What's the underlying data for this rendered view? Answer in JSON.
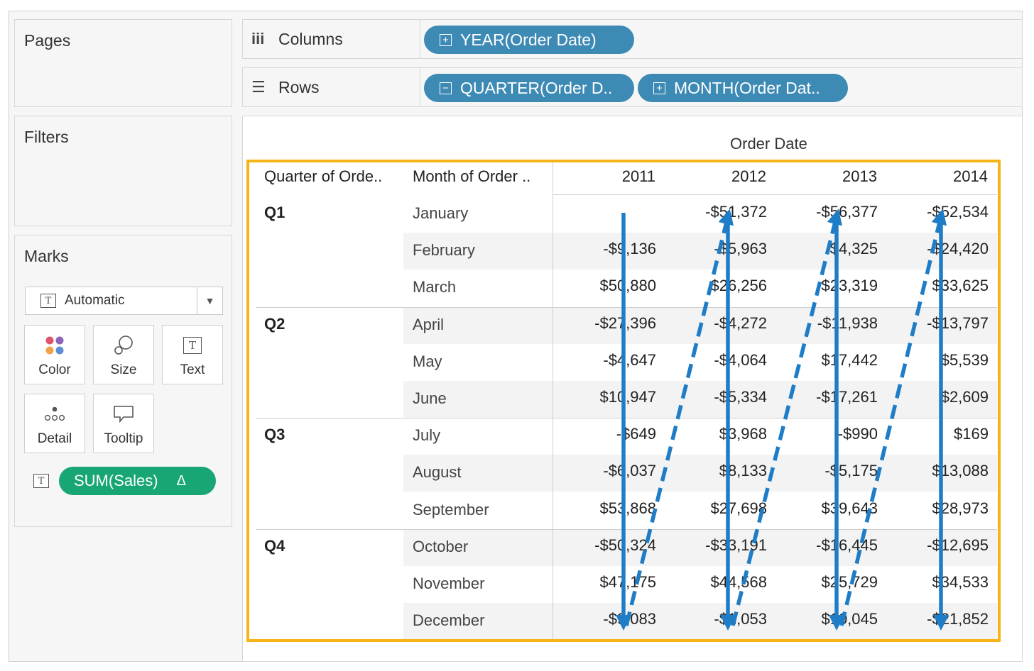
{
  "panels": {
    "pages": "Pages",
    "filters": "Filters",
    "marks": "Marks"
  },
  "marks": {
    "type_label": "Automatic",
    "buttons": [
      "Color",
      "Size",
      "Text",
      "Detail",
      "Tooltip"
    ],
    "pill_label": "SUM(Sales)",
    "pill_delta": "Δ"
  },
  "shelves": {
    "columns_label": "Columns",
    "rows_label": "Rows",
    "columns_pills": [
      "YEAR(Order Date)"
    ],
    "rows_pills": [
      "QUARTER(Order D..",
      "MONTH(Order Dat.."
    ]
  },
  "table": {
    "column_header": "Order Date",
    "row_headers": [
      "Quarter of Orde..",
      "Month of Order .."
    ],
    "years": [
      "2011",
      "2012",
      "2013",
      "2014"
    ],
    "quarters": [
      "Q1",
      "Q2",
      "Q3",
      "Q4"
    ],
    "rows": [
      {
        "month": "January",
        "values": [
          "",
          "-$51,372",
          "-$56,377",
          "-$52,534"
        ]
      },
      {
        "month": "February",
        "values": [
          "-$9,136",
          "-$5,963",
          "$4,325",
          "-$24,420"
        ]
      },
      {
        "month": "March",
        "values": [
          "$50,880",
          "$26,256",
          "$23,319",
          "$33,625"
        ]
      },
      {
        "month": "April",
        "values": [
          "-$27,396",
          "-$4,272",
          "-$11,938",
          "-$13,797"
        ]
      },
      {
        "month": "May",
        "values": [
          "-$4,647",
          "-$4,064",
          "$17,442",
          "$5,539"
        ]
      },
      {
        "month": "June",
        "values": [
          "$10,947",
          "-$5,334",
          "-$17,261",
          "$2,609"
        ]
      },
      {
        "month": "July",
        "values": [
          "-$649",
          "$3,968",
          "-$990",
          "$169"
        ]
      },
      {
        "month": "August",
        "values": [
          "-$6,037",
          "$8,133",
          "-$5,175",
          "$13,088"
        ]
      },
      {
        "month": "September",
        "values": [
          "$53,868",
          "$27,698",
          "$39,643",
          "$28,973"
        ]
      },
      {
        "month": "October",
        "values": [
          "-$50,324",
          "-$33,191",
          "-$16,445",
          "-$12,695"
        ]
      },
      {
        "month": "November",
        "values": [
          "$47,175",
          "$44,568",
          "$25,729",
          "$34,533"
        ]
      },
      {
        "month": "December",
        "values": [
          "-$9,083",
          "-$1,053",
          "$10,045",
          "-$21,852"
        ]
      }
    ]
  },
  "colors": {
    "pill_blue": "#3d8ab5",
    "pill_green": "#17a674",
    "highlight": "#f7b418",
    "arrow": "#1e7dc6"
  },
  "icons": [
    "columns-icon",
    "rows-icon",
    "expand-icon",
    "collapse-icon",
    "text-icon",
    "dropdown-icon",
    "color-icon",
    "size-icon",
    "detail-icon",
    "tooltip-icon",
    "delta-icon",
    "arrow-icon"
  ]
}
